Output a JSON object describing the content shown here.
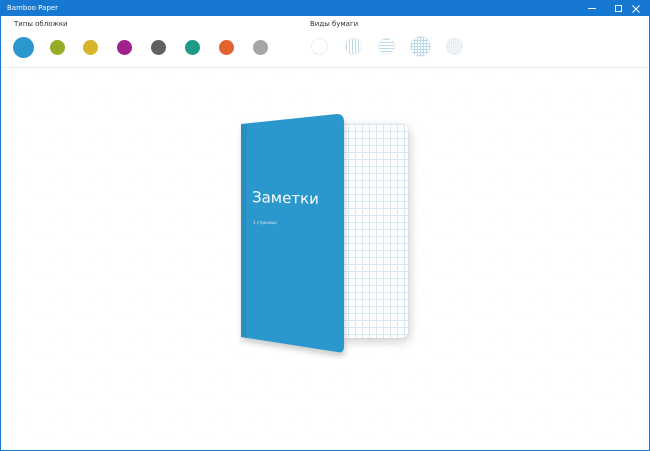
{
  "app": {
    "title": "Bamboo Paper"
  },
  "window_controls": {
    "minimize_icon": "minimize-icon",
    "maximize_icon": "maximize-icon",
    "close_icon": "close-icon"
  },
  "toolbar": {
    "cover_label": "Типы обложки",
    "paper_label": "Виды бумаги",
    "cover_colors": [
      {
        "name": "blue",
        "color": "#2a97cd",
        "selected": true
      },
      {
        "name": "olive",
        "color": "#96ad25",
        "selected": false
      },
      {
        "name": "yellow",
        "color": "#d7b52a",
        "selected": false
      },
      {
        "name": "purple",
        "color": "#a0228c",
        "selected": false
      },
      {
        "name": "gray",
        "color": "#616161",
        "selected": false
      },
      {
        "name": "teal",
        "color": "#1d9b86",
        "selected": false
      },
      {
        "name": "orange",
        "color": "#e26230",
        "selected": false
      },
      {
        "name": "light-gray",
        "color": "#a5a5a5",
        "selected": false
      }
    ],
    "paper_types": [
      {
        "name": "blank",
        "selected": false
      },
      {
        "name": "vertical-lines",
        "selected": false
      },
      {
        "name": "horizontal-lines",
        "selected": false
      },
      {
        "name": "grid",
        "selected": true
      },
      {
        "name": "fine-grid",
        "selected": false
      }
    ]
  },
  "notebook": {
    "title": "Заметки",
    "pages": "1 страница",
    "cover_color": "#2a97cd"
  }
}
